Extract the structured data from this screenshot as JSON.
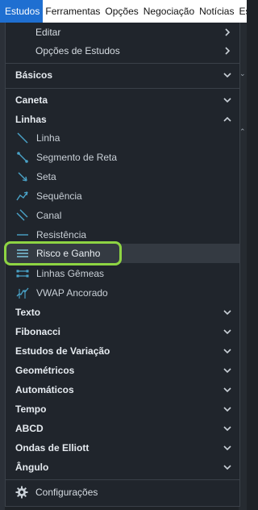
{
  "menubar": {
    "items": [
      "Estudos",
      "Ferramentas",
      "Opções",
      "Negociação",
      "Notícias",
      "Estu"
    ]
  },
  "dropdown": {
    "submenus": [
      {
        "label": "Editar"
      },
      {
        "label": "Opções de Estudos"
      }
    ],
    "categories": {
      "basicos": "Básicos",
      "caneta": "Caneta",
      "linhas": "Linhas",
      "texto": "Texto",
      "fibonacci": "Fibonacci",
      "estudos_variacao": "Estudos de Variação",
      "geometricos": "Geométricos",
      "automaticos": "Automáticos",
      "tempo": "Tempo",
      "abcd": "ABCD",
      "ondas_elliott": "Ondas de Elliott",
      "angulo": "Ângulo"
    },
    "linhas_tools": [
      {
        "label": "Linha",
        "icon": "line-icon"
      },
      {
        "label": "Segmento de Reta",
        "icon": "segment-icon"
      },
      {
        "label": "Seta",
        "icon": "arrow-icon"
      },
      {
        "label": "Sequência",
        "icon": "sequence-icon"
      },
      {
        "label": "Canal",
        "icon": "channel-icon"
      },
      {
        "label": "Resistência",
        "icon": "resistance-icon"
      },
      {
        "label": "Risco e Ganho",
        "icon": "risk-reward-icon",
        "highlighted": true
      },
      {
        "label": "Linhas Gêmeas",
        "icon": "twin-lines-icon"
      },
      {
        "label": "VWAP Ancorado",
        "icon": "vwap-icon"
      }
    ],
    "footer": {
      "label": "Configurações",
      "icon": "gear-icon"
    }
  },
  "colors": {
    "menu_active": "#1f6fd1",
    "panel_bg": "#20252c",
    "icon_accent": "#4aa3c8",
    "highlight_outline": "#8ed443"
  }
}
